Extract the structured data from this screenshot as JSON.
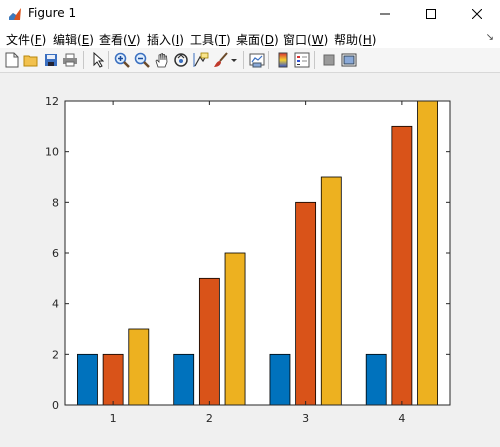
{
  "window": {
    "title": "Figure 1",
    "minimize_icon": "minimize-icon",
    "maximize_icon": "maximize-icon",
    "close_icon": "close-icon"
  },
  "menu": [
    {
      "label": "文件(",
      "key": "F",
      "suffix": ")"
    },
    {
      "label": "编辑(",
      "key": "E",
      "suffix": ")"
    },
    {
      "label": "查看(",
      "key": "V",
      "suffix": ")"
    },
    {
      "label": "插入(",
      "key": "I",
      "suffix": ")"
    },
    {
      "label": "工具(",
      "key": "T",
      "suffix": ")"
    },
    {
      "label": "桌面(",
      "key": "D",
      "suffix": ")"
    },
    {
      "label": "窗口(",
      "key": "W",
      "suffix": ")"
    },
    {
      "label": "帮助(",
      "key": "H",
      "suffix": ")"
    }
  ],
  "toolbar_icons": [
    "new-figure-icon",
    "open-file-icon",
    "save-icon",
    "print-icon",
    "select-pointer-icon",
    "zoom-in-icon",
    "zoom-out-icon",
    "pan-hand-icon",
    "rotate-3d-icon",
    "data-cursor-icon",
    "brush-icon",
    "brush-dropdown-icon",
    "link-plot-icon",
    "colorbar-icon",
    "legend-icon",
    "hide-plot-tools-icon",
    "show-plot-tools-icon"
  ],
  "colors": {
    "series1": "#0072BD",
    "series2": "#D95319",
    "series3": "#EDB120",
    "axes_bg": "#ffffff",
    "figure_bg": "#f0f0f0"
  },
  "chart_data": {
    "type": "bar",
    "categories": [
      "1",
      "2",
      "3",
      "4"
    ],
    "series": [
      {
        "values": [
          2,
          2,
          2,
          2
        ]
      },
      {
        "values": [
          2,
          5,
          8,
          11
        ]
      },
      {
        "values": [
          3,
          6,
          9,
          12
        ]
      }
    ],
    "yticks": [
      0,
      2,
      4,
      6,
      8,
      10,
      12
    ],
    "ylim": [
      0,
      12
    ],
    "title": "",
    "xlabel": "",
    "ylabel": "",
    "grid": false,
    "legend": false
  }
}
